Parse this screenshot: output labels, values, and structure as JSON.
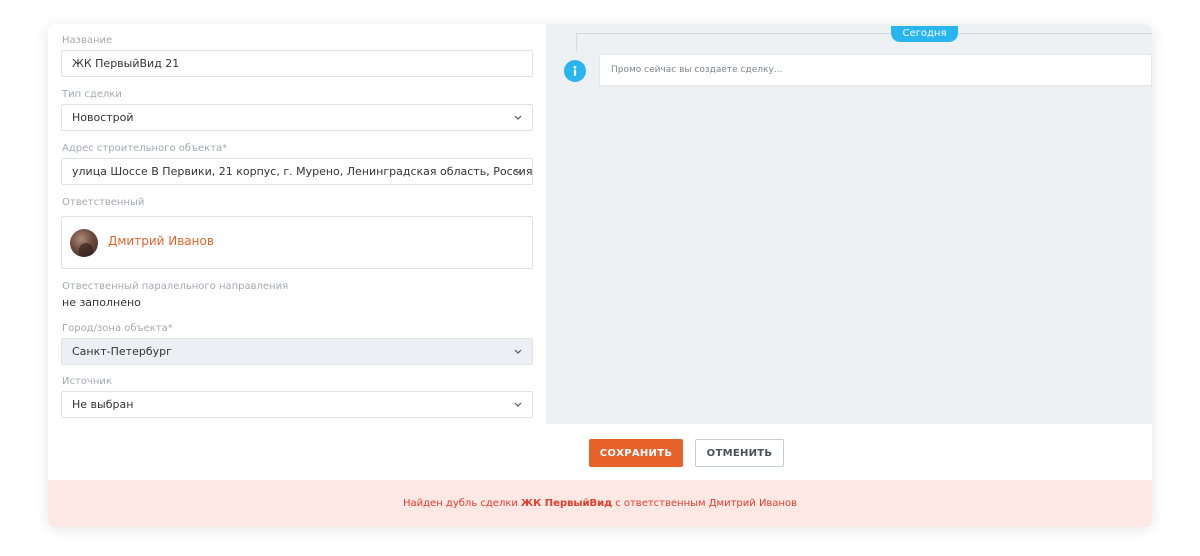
{
  "form": {
    "name": {
      "label": "Название",
      "value": "ЖК ПервыйВид 21"
    },
    "deal_type": {
      "label": "Тип сделки",
      "value": "Новострой"
    },
    "address": {
      "label": "Адрес строительного объекта*",
      "value": "улица Шоссе В Первики, 21 корпус, г. Мурено, Ленинградская область, Россия"
    },
    "responsible": {
      "label": "Ответственный",
      "value": "Дмитрий Иванов"
    },
    "parallel_responsible": {
      "label": "Отвественный паралельного направления",
      "value": "не заполнено"
    },
    "city": {
      "label": "Город/зона объекта*",
      "value": "Санкт-Петербург"
    },
    "source": {
      "label": "Источник",
      "value": "Не выбран"
    }
  },
  "timeline": {
    "badge": "Сегодня",
    "promo_text": "Промо сейчас вы создаете сделку...",
    "info_icon": "info-icon"
  },
  "footer": {
    "save_label": "СОХРАНИТЬ",
    "cancel_label": "ОТМЕНИТЬ"
  },
  "duplicate": {
    "prefix": "Найден дубль сделки",
    "deal": "ЖК ПервыйВид",
    "suffix": "с ответственным Дмитрий Иванов"
  },
  "colors": {
    "accent": "#e8622c",
    "info": "#29b6f0",
    "alert_bg": "#fde8e3",
    "alert_text": "#e23d2f"
  }
}
